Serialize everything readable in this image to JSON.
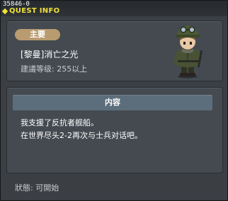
{
  "window": {
    "quest_id": "35846-0",
    "title": "QUEST INFO"
  },
  "quest": {
    "category_label": "主要",
    "name": "[黎曼]消亡之光",
    "level_requirement": "建議等级: 255以上"
  },
  "content": {
    "header": "内容",
    "lines": [
      "我支援了反抗者舰船。",
      "在世界尽头2-2再次与士兵对话吧。"
    ]
  },
  "status": {
    "text": "狀態: 可開始"
  },
  "colors": {
    "title_yellow": "#f2e13a",
    "badge_tan": "#b99b70",
    "header_blue": "#5c6e7c",
    "panel_gray": "#444a50"
  },
  "icons": {
    "npc_portrait": "soldier-npc-icon"
  }
}
